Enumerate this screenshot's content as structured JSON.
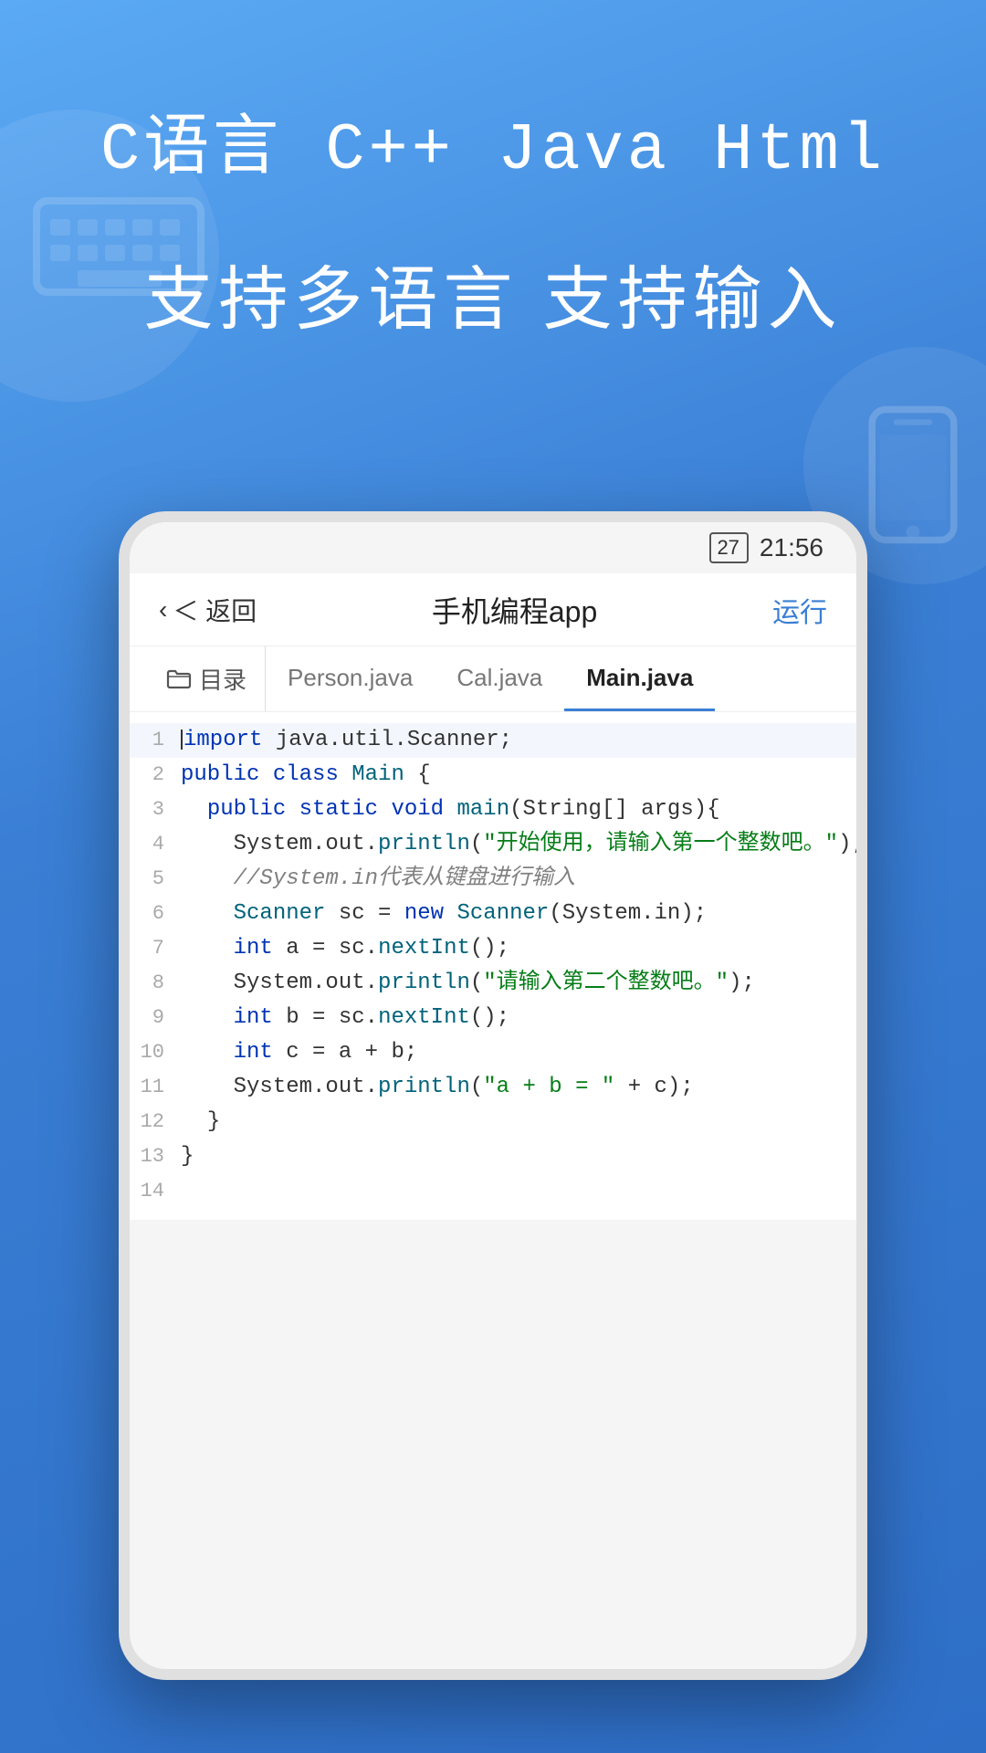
{
  "background": {
    "color_top": "#5baaf5",
    "color_bottom": "#2e6ec7"
  },
  "header": {
    "lang_line": "C语言  C++  Java  Html",
    "subtitle_line": "支持多语言 支持输入"
  },
  "phone": {
    "status_bar": {
      "battery": "27",
      "time": "21:56"
    },
    "app_bar": {
      "back_label": "＜ 返回",
      "title": "手机编程app",
      "run_label": "运行"
    },
    "tabs": [
      {
        "label": "目录",
        "icon": "folder",
        "active": false
      },
      {
        "label": "Person.java",
        "active": false
      },
      {
        "label": "Cal.java",
        "active": false
      },
      {
        "label": "Main.java",
        "active": true
      }
    ],
    "code_lines": [
      {
        "num": "1",
        "content": "import java.util.Scanner;",
        "type": "import"
      },
      {
        "num": "2",
        "content": "public class Main {",
        "type": "class_decl"
      },
      {
        "num": "3",
        "content": "    public static void main(String[] args){",
        "type": "method_decl"
      },
      {
        "num": "4",
        "content": "        System.out.println(\"开始使用，请输入第一个整数吧。\");",
        "type": "println"
      },
      {
        "num": "5",
        "content": "        //System.in代表从键盘进行输入",
        "type": "comment"
      },
      {
        "num": "6",
        "content": "        Scanner sc = new Scanner(System.in);",
        "type": "scanner"
      },
      {
        "num": "7",
        "content": "        int a = sc.nextInt();",
        "type": "int_decl"
      },
      {
        "num": "8",
        "content": "        System.out.println(\"请输入第二个整数吧。\");",
        "type": "println"
      },
      {
        "num": "9",
        "content": "        int b = sc.nextInt();",
        "type": "int_decl"
      },
      {
        "num": "10",
        "content": "        int c = a + b;",
        "type": "int_decl"
      },
      {
        "num": "11",
        "content": "        System.out.println(\"a + b = \" + c);",
        "type": "println"
      },
      {
        "num": "12",
        "content": "    }",
        "type": "brace"
      },
      {
        "num": "13",
        "content": "}",
        "type": "brace"
      },
      {
        "num": "14",
        "content": "",
        "type": "empty"
      }
    ]
  }
}
